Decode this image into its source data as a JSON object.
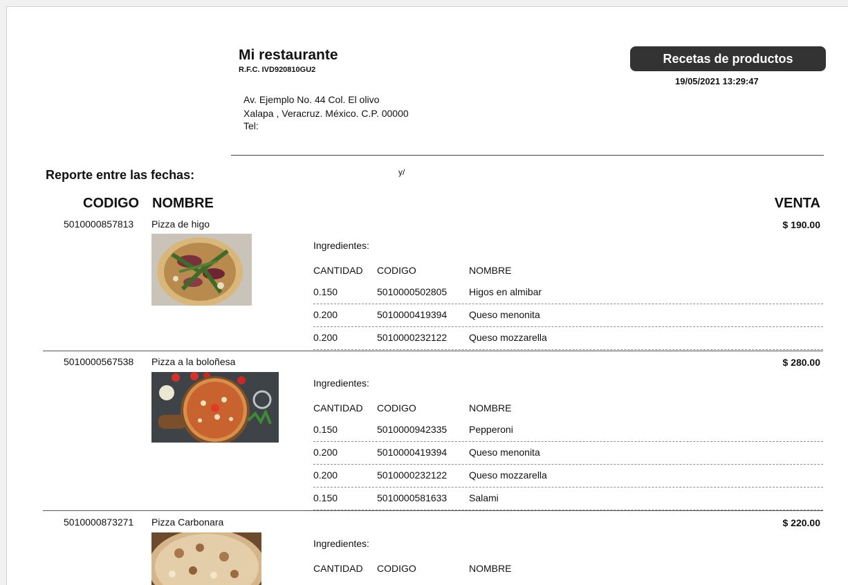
{
  "company": {
    "name": "Mi restaurante",
    "rfc": "R.F.C. IVD920810GU2",
    "address_line1": "Av. Ejemplo  No. 44  Col. El olivo",
    "address_line2": "Xalapa , Veracruz. México.  C.P. 00000",
    "address_line3": "Tel:"
  },
  "report": {
    "title": "Recetas de productos",
    "datetime": "19/05/2021 13:29:47",
    "date_range_label": "Reporte entre las fechas:",
    "date_separator": "y/"
  },
  "columns": {
    "code": "CODIGO",
    "name": "NOMBRE",
    "sale": "VENTA"
  },
  "ingredients_label": "Ingredientes:",
  "ingredient_columns": {
    "quantity": "CANTIDAD",
    "code": "CODIGO",
    "name": "NOMBRE"
  },
  "products": [
    {
      "code": "5010000857813",
      "name": "Pizza de higo",
      "price": "$ 190.00",
      "ingredients": [
        {
          "qty": "0.150",
          "code": "5010000502805",
          "name": "Higos en almibar"
        },
        {
          "qty": "0.200",
          "code": "5010000419394",
          "name": "Queso menonita"
        },
        {
          "qty": "0.200",
          "code": "5010000232122",
          "name": "Queso mozzarella"
        }
      ]
    },
    {
      "code": "5010000567538",
      "name": "Pizza a la boloñesa",
      "price": "$ 280.00",
      "ingredients": [
        {
          "qty": "0.150",
          "code": "5010000942335",
          "name": "Pepperoni"
        },
        {
          "qty": "0.200",
          "code": "5010000419394",
          "name": "Queso menonita"
        },
        {
          "qty": "0.200",
          "code": "5010000232122",
          "name": "Queso mozzarella"
        },
        {
          "qty": "0.150",
          "code": "5010000581633",
          "name": "Salami"
        }
      ]
    },
    {
      "code": "5010000873271",
      "name": "Pizza Carbonara",
      "price": "$ 220.00",
      "ingredients": []
    }
  ]
}
